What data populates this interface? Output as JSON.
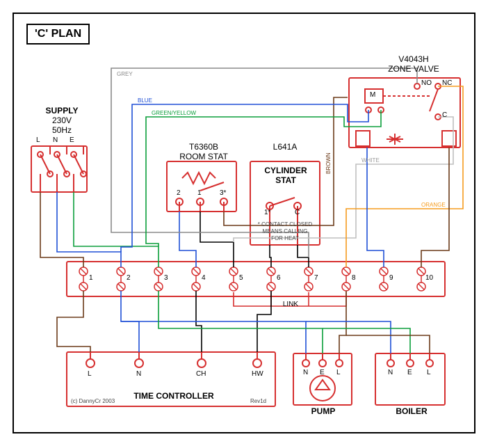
{
  "title": "'C' PLAN",
  "supply": {
    "label1": "SUPPLY",
    "label2": "230V",
    "label3": "50Hz",
    "L": "L",
    "N": "N",
    "E": "E"
  },
  "zoneValve": {
    "label1": "V4043H",
    "label2": "ZONE VALVE",
    "M": "M",
    "NO": "NO",
    "NC": "NC",
    "C": "C"
  },
  "roomStat": {
    "label1": "T6360B",
    "label2": "ROOM STAT",
    "t1": "1",
    "t2": "2",
    "t3": "3*"
  },
  "cylStat": {
    "label1": "L641A",
    "label2": "CYLINDER",
    "label3": "STAT",
    "note1": "* CONTACT CLOSED",
    "note2": "MEANS CALLING",
    "note3": "FOR HEAT",
    "t1": "1*",
    "tC": "C"
  },
  "wiringCentre": {
    "link": "LINK",
    "t1": "1",
    "t2": "2",
    "t3": "3",
    "t4": "4",
    "t5": "5",
    "t6": "6",
    "t7": "7",
    "t8": "8",
    "t9": "9",
    "t10": "10"
  },
  "timeController": {
    "label": "TIME CONTROLLER",
    "L": "L",
    "N": "N",
    "CH": "CH",
    "HW": "HW"
  },
  "pump": {
    "label": "PUMP",
    "N": "N",
    "E": "E",
    "L": "L"
  },
  "boiler": {
    "label": "BOILER",
    "N": "N",
    "E": "E",
    "L": "L"
  },
  "wires": {
    "grey": "GREY",
    "blue": "BLUE",
    "greenyellow": "GREEN/YELLOW",
    "brown": "BROWN",
    "white": "WHITE",
    "orange": "ORANGE"
  },
  "credits": {
    "copyright": "(c) DannyCr 2003",
    "rev": "Rev1d"
  },
  "colors": {
    "red": "#d62f2f",
    "blue": "#1e4fd6",
    "green": "#0a9e3a",
    "orange": "#f59b1d",
    "brown": "#6b3a18",
    "grey": "#8a8a8a",
    "black": "#000",
    "white": "#cfcfcf"
  }
}
